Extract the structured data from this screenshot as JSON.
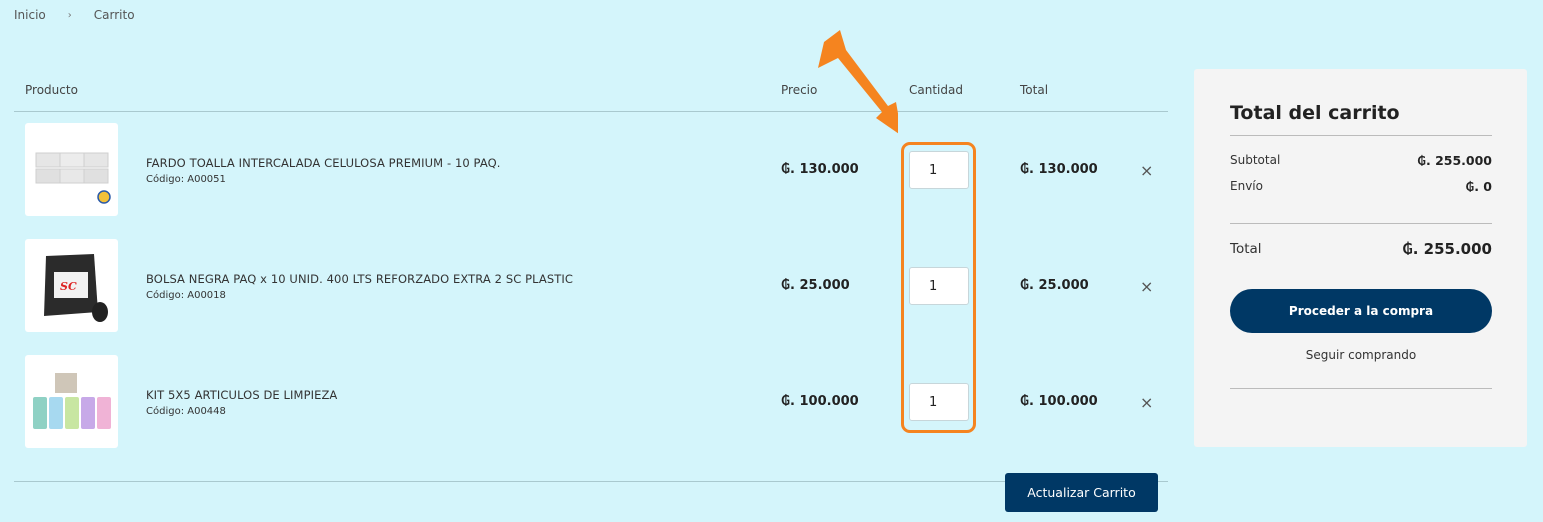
{
  "breadcrumb": {
    "home": "Inicio",
    "separator": "›",
    "current": "Carrito"
  },
  "table": {
    "headers": {
      "product": "Producto",
      "price": "Precio",
      "quantity": "Cantidad",
      "total": "Total"
    },
    "items": [
      {
        "name": "FARDO TOALLA INTERCALADA CELULOSA PREMIUM - 10 PAQ.",
        "code": "Código: A00051",
        "price": "₲. 130.000",
        "quantity": "1",
        "total": "₲. 130.000",
        "remove": "×"
      },
      {
        "name": "BOLSA NEGRA PAQ x 10 UNID. 400 LTS REFORZADO EXTRA 2 SC PLASTIC",
        "code": "Código: A00018",
        "price": "₲. 25.000",
        "quantity": "1",
        "total": "₲. 25.000",
        "remove": "×"
      },
      {
        "name": "KIT 5X5 ARTICULOS DE LIMPIEZA",
        "code": "Código: A00448",
        "price": "₲. 100.000",
        "quantity": "1",
        "total": "₲. 100.000",
        "remove": "×"
      }
    ],
    "update_label": "Actualizar Carrito"
  },
  "summary": {
    "title": "Total del carrito",
    "subtotal_label": "Subtotal",
    "subtotal_value": "₲. 255.000",
    "shipping_label": "Envío",
    "shipping_value": "₲. 0",
    "total_label": "Total",
    "total_value": "₲. 255.000",
    "checkout_label": "Proceder a la compra",
    "continue_label": "Seguir comprando"
  },
  "colors": {
    "background": "#d4f5fb",
    "primary": "#003865",
    "highlight": "#f5841f"
  }
}
